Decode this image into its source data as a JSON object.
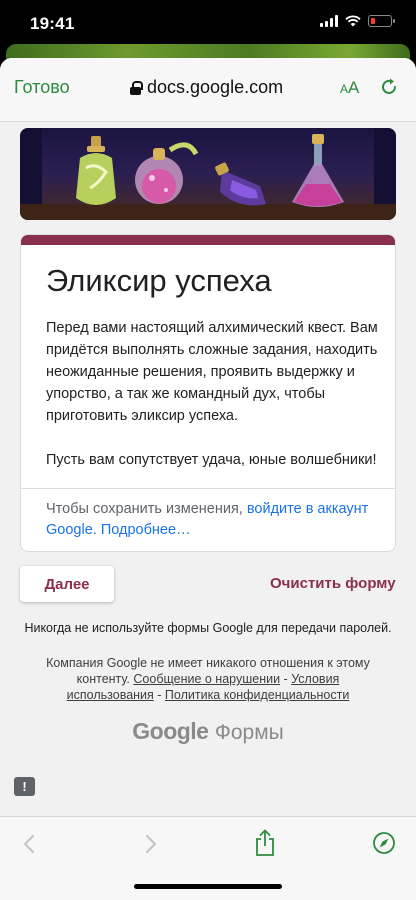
{
  "status_bar": {
    "time": "19:41"
  },
  "browser": {
    "done_label": "Готово",
    "url": "docs.google.com",
    "text_size_label": "AA"
  },
  "form": {
    "title": "Эликсир успеха",
    "description": "Перед вами настоящий алхимический квест. Вам придётся выполнять сложные задания, находить неожиданные решения, проявить выдержку и упорство, а так же командный дух, чтобы приготовить эликсир успеха.\n\nПусть вам сопутствует удача, юные волшебники!",
    "signin_text": "Чтобы сохранить изменения, ",
    "signin_link": "войдите в аккаунт Google.",
    "more_link": "Подробнее…",
    "next_button": "Далее",
    "clear_button": "Очистить форму",
    "accent_color": "#8a2f4e"
  },
  "footer": {
    "password_warning": "Никогда не используйте формы Google для передачи паролей.",
    "legal_prefix": "Компания Google не имеет никакого отношения к этому контенту.",
    "report_link": "Сообщение о нарушении",
    "separator": " - ",
    "terms_link": "Условия использования",
    "privacy_link": "Политика конфиденциальности",
    "logo_google": "Google",
    "logo_forms": "Формы"
  },
  "icons": {
    "back": "chevron-left-icon",
    "forward": "chevron-right-icon",
    "share": "share-icon",
    "safari": "compass-icon",
    "reload": "reload-icon",
    "feedback": "feedback-icon"
  }
}
